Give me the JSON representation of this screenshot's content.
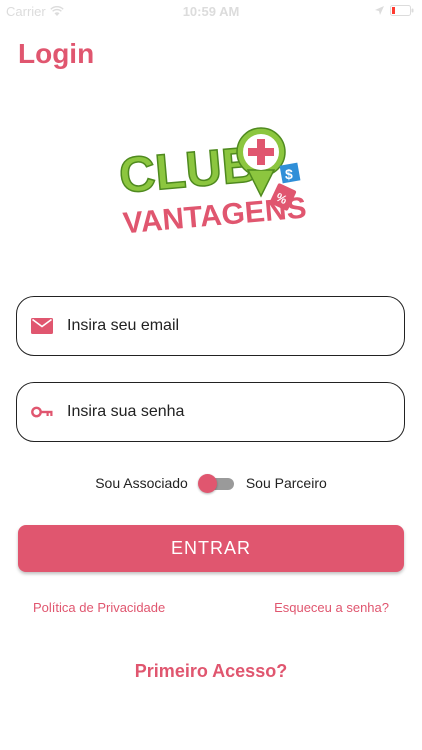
{
  "status_bar": {
    "carrier": "Carrier",
    "time": "10:59 AM"
  },
  "header": {
    "title": "Login"
  },
  "logo": {
    "line1": "CLUB",
    "line2": "VANTAGENS",
    "badge_dollar": "$",
    "badge_percent": "%"
  },
  "form": {
    "email_placeholder": "Insira seu email",
    "password_placeholder": "Insira sua senha"
  },
  "toggle": {
    "left_label": "Sou Associado",
    "right_label": "Sou Parceiro"
  },
  "actions": {
    "submit_label": "ENTRAR",
    "privacy_label": "Política de Privacidade",
    "forgot_label": "Esqueceu a senha?",
    "first_access_label": "Primeiro Acesso?"
  },
  "colors": {
    "accent": "#e0566f",
    "logo_green": "#8cc63f",
    "logo_pink": "#e0566f",
    "logo_blue": "#2f8fd8"
  }
}
